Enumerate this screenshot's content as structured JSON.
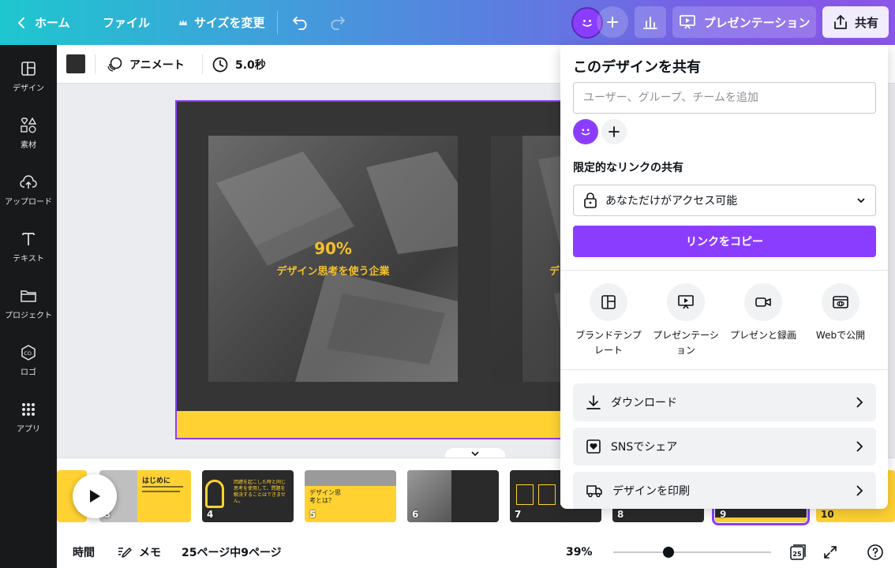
{
  "topbar": {
    "home_label": "ホーム",
    "file_label": "ファイル",
    "resize_label": "サイズを変更",
    "present_label": "プレゼンテーション",
    "share_label": "共有"
  },
  "sidebar": {
    "items": [
      {
        "label": "デザイン",
        "icon": "layout-icon"
      },
      {
        "label": "素材",
        "icon": "shapes-icon"
      },
      {
        "label": "アップロード",
        "icon": "cloud-upload-icon"
      },
      {
        "label": "テキスト",
        "icon": "text-icon"
      },
      {
        "label": "プロジェクト",
        "icon": "folder-icon"
      },
      {
        "label": "ロゴ",
        "icon": "logo-icon"
      },
      {
        "label": "アプリ",
        "icon": "apps-grid-icon"
      }
    ]
  },
  "toolbar": {
    "color": "#2d2d2d",
    "animate_label": "アニメート",
    "duration_label": "5.0秒"
  },
  "slide": {
    "stat_value": "90%",
    "stat_label": "デザイン思考を使う企業",
    "stat_label_partial": "デ"
  },
  "filmstrip": {
    "thumbs": [
      {
        "num": "",
        "title": "",
        "bg": "#ffd232"
      },
      {
        "num": "3",
        "title": "はじめに",
        "bg": "#ffd232"
      },
      {
        "num": "4",
        "title": "問題を起こした時と同じ思考を使用して、問題を解決することはできません。",
        "bg": "#2a2a2a"
      },
      {
        "num": "5",
        "title": "デザイン思考とは？",
        "bg": "#ffd232"
      },
      {
        "num": "6",
        "title": "",
        "bg": "#2a2a2a"
      },
      {
        "num": "7",
        "title": "",
        "bg": "#2a2a2a"
      },
      {
        "num": "8",
        "title": "",
        "bg": "#2a2a2a"
      },
      {
        "num": "9",
        "title": "",
        "bg": "#2a2a2a"
      },
      {
        "num": "10",
        "title": "",
        "bg": "#ffd232"
      }
    ]
  },
  "bottombar": {
    "time_label": "時間",
    "notes_label": "メモ",
    "page_info": "25ページ中9ページ",
    "zoom": "39%",
    "zoom_value": 0.39,
    "page_count": "25"
  },
  "share_panel": {
    "title": "このデザインを共有",
    "input_placeholder": "ユーザー、グループ、チームを追加",
    "link_heading": "限定的なリンクの共有",
    "access_label": "あなただけがアクセス可能",
    "copy_button": "リンクをコピー",
    "options": [
      {
        "line1": "ブランドテンプ",
        "line2": "レート",
        "icon": "brand-template-icon"
      },
      {
        "line1": "プレゼンテーシ",
        "line2": "ョン",
        "icon": "present-icon"
      },
      {
        "line1": "プレゼンと録画",
        "line2": "",
        "icon": "record-icon"
      },
      {
        "line1": "Webで公開",
        "line2": "",
        "icon": "web-publish-icon"
      }
    ],
    "rows": [
      {
        "label": "ダウンロード",
        "icon": "download-icon"
      },
      {
        "label": "SNSでシェア",
        "icon": "social-heart-icon"
      },
      {
        "label": "デザインを印刷",
        "icon": "print-truck-icon"
      }
    ]
  },
  "colors": {
    "accent": "#8b3dff",
    "slide_yellow": "#ffd232",
    "stat_gold": "#f3c02c"
  }
}
